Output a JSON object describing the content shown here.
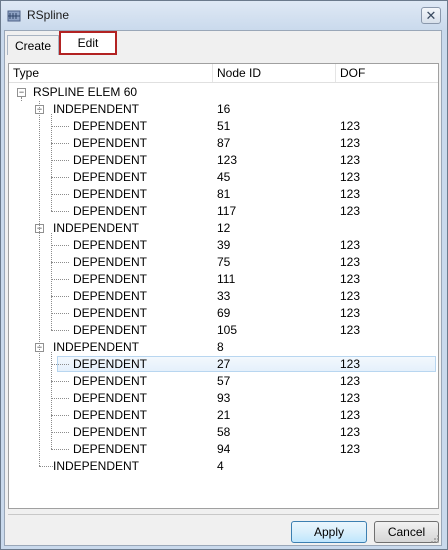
{
  "window": {
    "title": "RSpline"
  },
  "tabs": [
    {
      "label": "Create"
    },
    {
      "label": "Edit"
    }
  ],
  "columns": {
    "type": "Type",
    "node_id": "Node ID",
    "dof": "DOF"
  },
  "tree": {
    "root": "RSPLINE ELEM 60",
    "groups": [
      {
        "type": "INDEPENDENT",
        "node": "16",
        "children": [
          {
            "type": "DEPENDENT",
            "node": "51",
            "dof": "123"
          },
          {
            "type": "DEPENDENT",
            "node": "87",
            "dof": "123"
          },
          {
            "type": "DEPENDENT",
            "node": "123",
            "dof": "123"
          },
          {
            "type": "DEPENDENT",
            "node": "45",
            "dof": "123"
          },
          {
            "type": "DEPENDENT",
            "node": "81",
            "dof": "123"
          },
          {
            "type": "DEPENDENT",
            "node": "117",
            "dof": "123"
          }
        ]
      },
      {
        "type": "INDEPENDENT",
        "node": "12",
        "children": [
          {
            "type": "DEPENDENT",
            "node": "39",
            "dof": "123"
          },
          {
            "type": "DEPENDENT",
            "node": "75",
            "dof": "123"
          },
          {
            "type": "DEPENDENT",
            "node": "111",
            "dof": "123"
          },
          {
            "type": "DEPENDENT",
            "node": "33",
            "dof": "123"
          },
          {
            "type": "DEPENDENT",
            "node": "69",
            "dof": "123"
          },
          {
            "type": "DEPENDENT",
            "node": "105",
            "dof": "123"
          }
        ]
      },
      {
        "type": "INDEPENDENT",
        "node": "8",
        "children": [
          {
            "type": "DEPENDENT",
            "node": "27",
            "dof": "123",
            "selected": true
          },
          {
            "type": "DEPENDENT",
            "node": "57",
            "dof": "123"
          },
          {
            "type": "DEPENDENT",
            "node": "93",
            "dof": "123"
          },
          {
            "type": "DEPENDENT",
            "node": "21",
            "dof": "123"
          },
          {
            "type": "DEPENDENT",
            "node": "58",
            "dof": "123"
          },
          {
            "type": "DEPENDENT",
            "node": "94",
            "dof": "123"
          }
        ]
      },
      {
        "type": "INDEPENDENT",
        "node": "4",
        "children": []
      }
    ]
  },
  "buttons": {
    "apply": "Apply",
    "cancel": "Cancel"
  }
}
